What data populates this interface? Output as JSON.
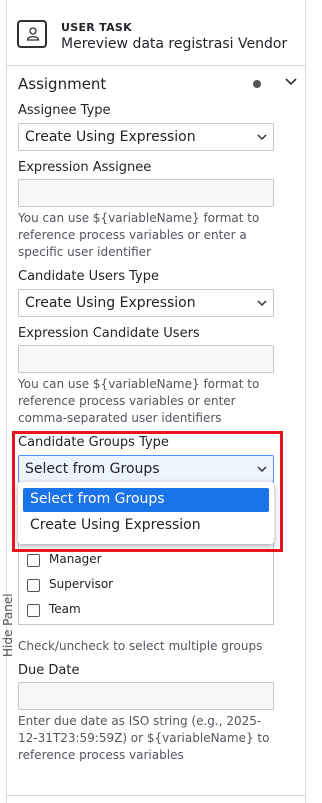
{
  "header": {
    "type_label": "USER TASK",
    "element_name": "Mereview data registrasi Vendor",
    "icon": "user-task-icon"
  },
  "side": {
    "hide_panel_label": "Hide Panel"
  },
  "group": {
    "title": "Assignment"
  },
  "fields": {
    "assignee_type": {
      "label": "Assignee Type",
      "value": "Create Using Expression"
    },
    "expression_assignee": {
      "label": "Expression Assignee",
      "value": "",
      "hint": "You can use ${variableName} format to reference process variables or enter a specific user identifier"
    },
    "candidate_users_type": {
      "label": "Candidate Users Type",
      "value": "Create Using Expression"
    },
    "expression_candidate_users": {
      "label": "Expression Candidate Users",
      "value": "",
      "hint": "You can use ${variableName} format to reference process variables or enter comma-separated user identifiers"
    },
    "candidate_groups_type": {
      "label": "Candidate Groups Type",
      "value": "Select from Groups",
      "options": [
        "Select from Groups",
        "Create Using Expression"
      ]
    },
    "groups": {
      "items": [
        "Manager",
        "Supervisor",
        "Team"
      ],
      "hint": "Check/uncheck to select multiple groups"
    },
    "due_date": {
      "label": "Due Date",
      "value": "",
      "hint": "Enter due date as ISO string (e.g., 2025-12-31T23:59:59Z) or ${variableName} to reference process variables"
    }
  },
  "colors": {
    "highlight": "#e8141e",
    "selected_option": "#1a73e8",
    "focus_border": "#4d90fe"
  }
}
